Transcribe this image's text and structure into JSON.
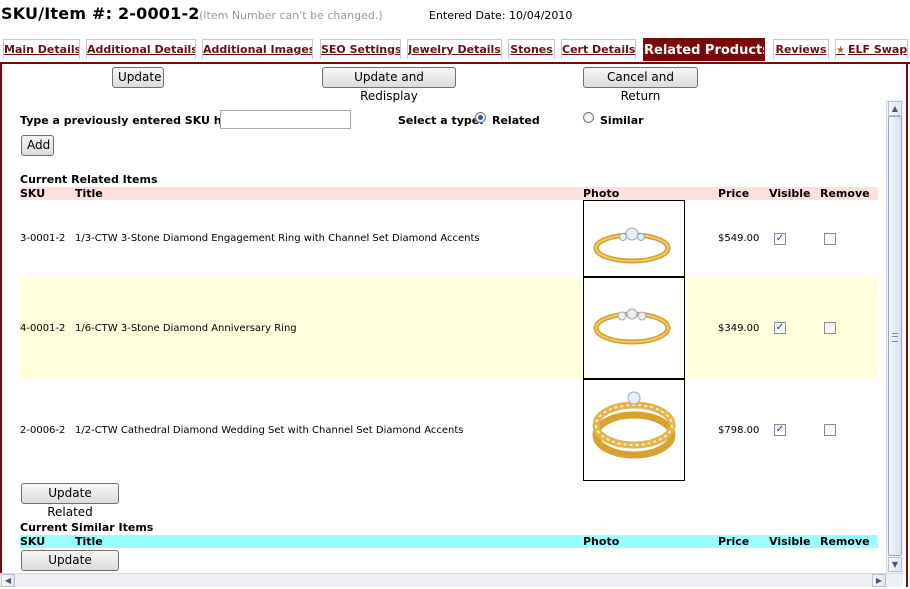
{
  "header": {
    "sku_title": "SKU/Item #: 2-0001-2",
    "sku_note": "(Item Number can't be changed.)",
    "entered_date": "Entered Date: 10/04/2010"
  },
  "tabs": [
    {
      "label": "Main Details"
    },
    {
      "label": "Additional Details"
    },
    {
      "label": "Additional Images"
    },
    {
      "label": "SEO Settings"
    },
    {
      "label": "Jewelry Details"
    },
    {
      "label": "Stones"
    },
    {
      "label": "Cert Details"
    },
    {
      "label": "Related Products",
      "active": true
    },
    {
      "label": "Reviews"
    },
    {
      "label": "ELF Swap"
    }
  ],
  "toolbar": {
    "update_label": "Update",
    "update_redisplay_label": "Update and Redisplay",
    "cancel_return_label": "Cancel and Return"
  },
  "add_form": {
    "sku_prompt": "Type a previously entered SKU here:",
    "sku_value": "",
    "type_prompt": "Select a type:",
    "type_options": [
      "Related",
      "Similar"
    ],
    "selected_type": "Related",
    "add_label": "Add"
  },
  "related": {
    "section_title": "Current Related Items",
    "columns": {
      "sku": "SKU",
      "title": "Title",
      "photo": "Photo",
      "price": "Price",
      "visible": "Visible",
      "remove": "Remove"
    },
    "rows": [
      {
        "sku": "3-0001-2",
        "title": "1/3-CTW 3-Stone Diamond Engagement Ring with Channel Set Diamond Accents",
        "price": "$549.00",
        "visible": true,
        "remove": false
      },
      {
        "sku": "4-0001-2",
        "title": "1/6-CTW 3-Stone Diamond Anniversary Ring",
        "price": "$349.00",
        "visible": true,
        "remove": false
      },
      {
        "sku": "2-0006-2",
        "title": "1/2-CTW Cathedral Diamond Wedding Set with Channel Set Diamond Accents",
        "price": "$798.00",
        "visible": true,
        "remove": false
      }
    ],
    "update_label": "Update Related"
  },
  "similar": {
    "section_title": "Current Similar Items",
    "columns": {
      "sku": "SKU",
      "title": "Title",
      "photo": "Photo",
      "price": "Price",
      "visible": "Visible",
      "remove": "Remove"
    },
    "update_label": "Update Related"
  },
  "colors": {
    "brand_maroon": "#7a0a0a",
    "related_header_bg": "#fce0e0",
    "similar_header_bg": "#99ffff",
    "alt_row_bg": "#ffffdd"
  },
  "icons": {
    "elf_swap": "star-icon"
  }
}
